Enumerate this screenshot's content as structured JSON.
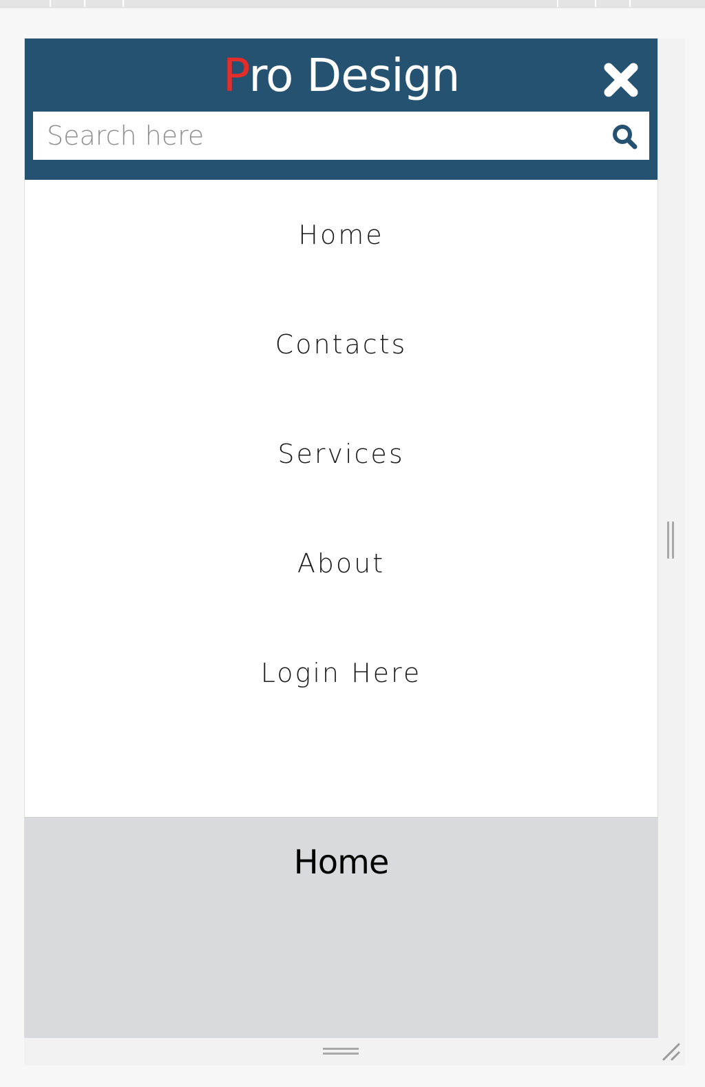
{
  "brand": {
    "first_letter": "P",
    "rest": "ro Design",
    "accent_color": "#e32d2a",
    "header_color": "#255271"
  },
  "header": {
    "close_icon": "close-icon"
  },
  "search": {
    "placeholder": "Search here",
    "value": "",
    "icon": "search-icon"
  },
  "nav": {
    "items": [
      {
        "label": "Home"
      },
      {
        "label": "Contacts"
      },
      {
        "label": "Services"
      },
      {
        "label": "About"
      },
      {
        "label": "Login Here"
      }
    ]
  },
  "content": {
    "title": "Home",
    "background_color": "#d9dadd"
  }
}
